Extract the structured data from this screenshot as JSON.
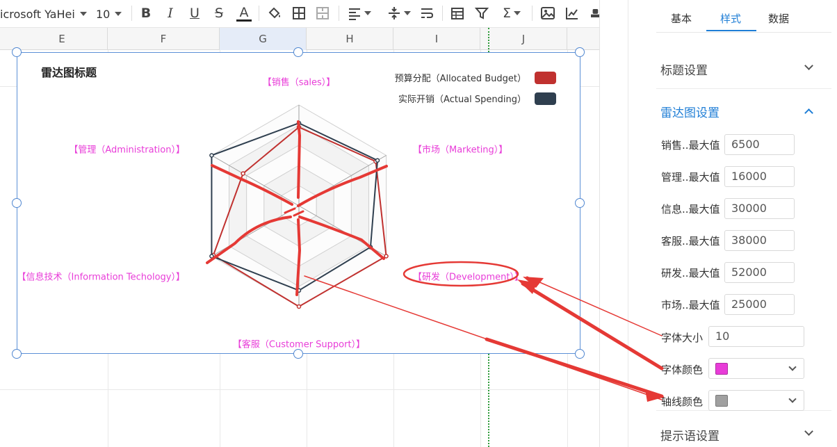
{
  "toolbar": {
    "font_name": "icrosoft YaHei",
    "font_size": "10",
    "bold_label": "B",
    "italic_label": "I",
    "underline_label": "U",
    "strike_label": "S",
    "fontcolor_label": "A",
    "sum_label": "Σ"
  },
  "sheet": {
    "columns": [
      "E",
      "F",
      "G",
      "H",
      "I",
      "J"
    ],
    "selected_column": "G"
  },
  "chart": {
    "title": "雷达图标题",
    "legend": [
      {
        "label": "预算分配（Allocated Budget）",
        "color": "#c0312f"
      },
      {
        "label": "实际开销（Actual Spending）",
        "color": "#2f3f4f"
      }
    ],
    "axis_label_color": "#e83cd8",
    "axis_line_color": "#a0a0a0",
    "axes": [
      {
        "label": "【销售（sales）】"
      },
      {
        "label": "【市场（Marketing）】"
      },
      {
        "label": "【研发（Development）】"
      },
      {
        "label": "【客服（Customer Support）】"
      },
      {
        "label": "【信息技术（Information Techology）】"
      },
      {
        "label": "【管理（Administration）】"
      }
    ]
  },
  "chart_data": {
    "type": "radar",
    "title": "雷达图标题",
    "indicators": [
      {
        "name": "【销售（sales）】",
        "max": 6500
      },
      {
        "name": "【市场（Marketing）】",
        "max": 25000
      },
      {
        "name": "【研发（Development）】",
        "max": 52000
      },
      {
        "name": "【客服（Customer Support）】",
        "max": 38000
      },
      {
        "name": "【信息技术（Information Techology）】",
        "max": 30000
      },
      {
        "name": "【管理（Administration）】",
        "max": 16000
      }
    ],
    "series": [
      {
        "name": "预算分配（Allocated Budget）",
        "color": "#c0312f",
        "fractions": [
          0.78,
          0.88,
          1.0,
          1.0,
          0.98,
          0.64
        ]
      },
      {
        "name": "实际开销（Actual Spending）",
        "color": "#2f3f4f",
        "fractions": [
          0.82,
          0.9,
          0.82,
          0.84,
          1.0,
          1.0
        ]
      }
    ],
    "legend_position": "top-right",
    "split_number": 5
  },
  "panel": {
    "tabs": [
      {
        "label": "基本",
        "active": false
      },
      {
        "label": "样式",
        "active": true
      },
      {
        "label": "数据",
        "active": false
      }
    ],
    "sections": {
      "title_settings": "标题设置",
      "radar_settings": "雷达图设置",
      "tooltip_settings": "提示语设置"
    },
    "max_fields": [
      {
        "label": "销售..最大值",
        "value": "6500"
      },
      {
        "label": "管理..最大值",
        "value": "16000"
      },
      {
        "label": "信息..最大值",
        "value": "30000"
      },
      {
        "label": "客服..最大值",
        "value": "38000"
      },
      {
        "label": "研发..最大值",
        "value": "52000"
      },
      {
        "label": "市场..最大值",
        "value": "25000"
      }
    ],
    "font_size_label": "字体大小",
    "font_size_value": "10",
    "font_color_label": "字体颜色",
    "font_color_value": "#e83cd8",
    "axis_color_label": "轴线颜色",
    "axis_color_value": "#a0a0a0"
  },
  "annotations": {
    "stroke_color": "#e53935"
  }
}
